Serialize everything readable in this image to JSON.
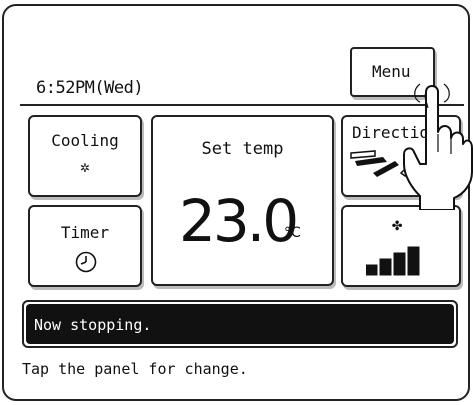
{
  "header": {
    "clock": "6:52PM(Wed)",
    "menu_label": "Menu"
  },
  "tiles": {
    "mode": {
      "label": "Cooling",
      "icon": "snowflake-icon",
      "glyph": "✲"
    },
    "set_temp": {
      "label": "Set temp",
      "value": "23.0",
      "unit": "°C"
    },
    "direction": {
      "label": "Direction",
      "icon": "louver-direction-icon"
    },
    "timer": {
      "label": "Timer",
      "icon": "clock-icon"
    },
    "fan": {
      "icon": "fan-icon",
      "glyph": "✤",
      "speed_levels_filled": 4,
      "speed_levels_total": 4
    }
  },
  "status": {
    "message": "Now stopping."
  },
  "hint": "Tap the panel for change."
}
